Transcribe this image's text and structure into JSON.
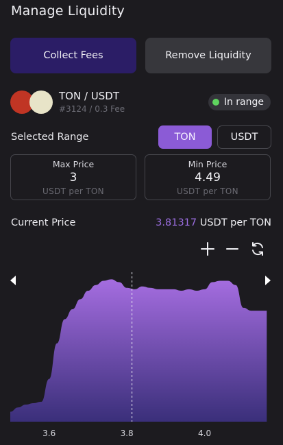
{
  "header": {
    "title": "Manage Liquidity"
  },
  "actions": {
    "collect_label": "Collect Fees",
    "remove_label": "Remove Liquidity"
  },
  "position": {
    "pair": "TON / USDT",
    "subtitle": "#3124 / 0.3 Fee",
    "status": "In range",
    "status_color": "#5fd45f",
    "coin_colors": [
      "#c03524",
      "#e8e4c8"
    ]
  },
  "range": {
    "label": "Selected Range",
    "tokens": [
      "TON",
      "USDT"
    ],
    "selected": "TON",
    "max": {
      "label": "Max Price",
      "value": "3",
      "unit": "USDT per TON"
    },
    "min": {
      "label": "Min Price",
      "value": "4.49",
      "unit": "USDT per TON"
    }
  },
  "current": {
    "label": "Current Price",
    "value": "3.81317",
    "unit": "USDT per TON"
  },
  "controls": [
    "plus-icon",
    "minus-icon",
    "refresh-icon"
  ],
  "colors": {
    "accent": "#8b5bd6",
    "accent_dark": "#2b1d66",
    "background": "#1c1b1f"
  },
  "chart_data": {
    "type": "area",
    "x": [
      3.5,
      3.52,
      3.54,
      3.56,
      3.58,
      3.6,
      3.62,
      3.64,
      3.66,
      3.68,
      3.7,
      3.72,
      3.74,
      3.76,
      3.78,
      3.8,
      3.82,
      3.84,
      3.86,
      3.88,
      3.9,
      3.92,
      3.94,
      3.96,
      3.98,
      4.0,
      4.02,
      4.04,
      4.06,
      4.08,
      4.1,
      4.12,
      4.14,
      4.16
    ],
    "values": [
      0.07,
      0.1,
      0.12,
      0.13,
      0.14,
      0.3,
      0.55,
      0.72,
      0.79,
      0.86,
      0.92,
      0.96,
      0.99,
      1.0,
      0.98,
      0.94,
      0.93,
      0.95,
      0.94,
      0.93,
      0.93,
      0.93,
      0.92,
      0.93,
      0.92,
      0.93,
      0.98,
      0.99,
      0.99,
      0.96,
      0.8,
      0.78,
      0.78,
      0.78
    ],
    "xticks": [
      "3.6",
      "3.8",
      "4.0"
    ],
    "xtick_values": [
      3.6,
      3.8,
      4.0
    ],
    "xlim": [
      3.5,
      4.17
    ],
    "ylim": [
      0,
      1.05
    ],
    "current_price": 3.81317,
    "gradient": [
      "#a56de0",
      "#3a2f7a"
    ]
  }
}
